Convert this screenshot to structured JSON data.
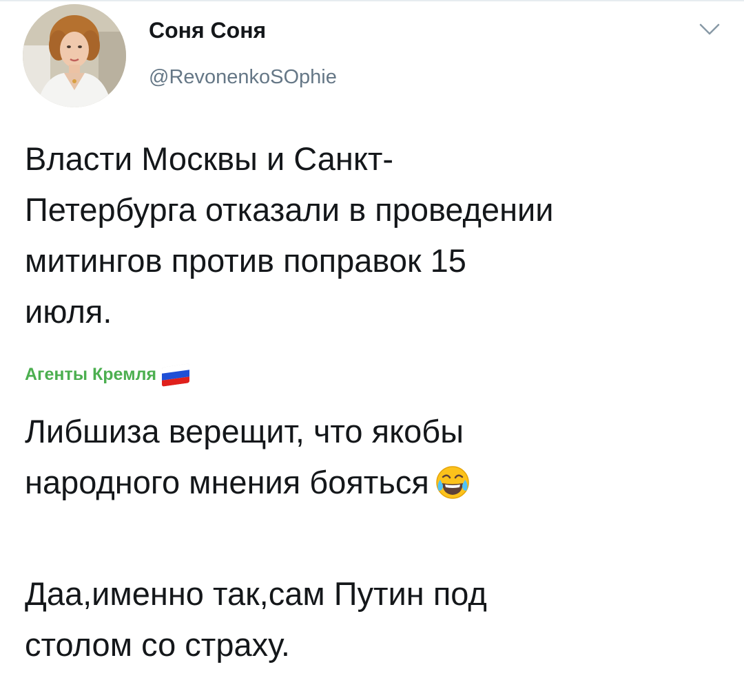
{
  "tweet": {
    "display_name": "Соня Соня",
    "handle": "@RevonenkoSOphie",
    "menu_icon": "chevron-down-icon",
    "avatar_icon": "profile-photo",
    "text_lines": [
      "Власти Москвы и Санкт-",
      "Петербурга отказали в проведении",
      "митингов против поправок 15",
      "июля."
    ]
  },
  "comment": {
    "author": "Агенты Кремля",
    "author_color": "#4caf50",
    "author_icon": "russian-flag-icon",
    "lines": [
      "Либшиза верещит, что якобы",
      "народного мнения бояться"
    ],
    "emoji_icon": "face-with-tears-of-joy-icon",
    "lines2": [
      "Даа,именно так,сам Путин под",
      "столом со страху."
    ]
  }
}
